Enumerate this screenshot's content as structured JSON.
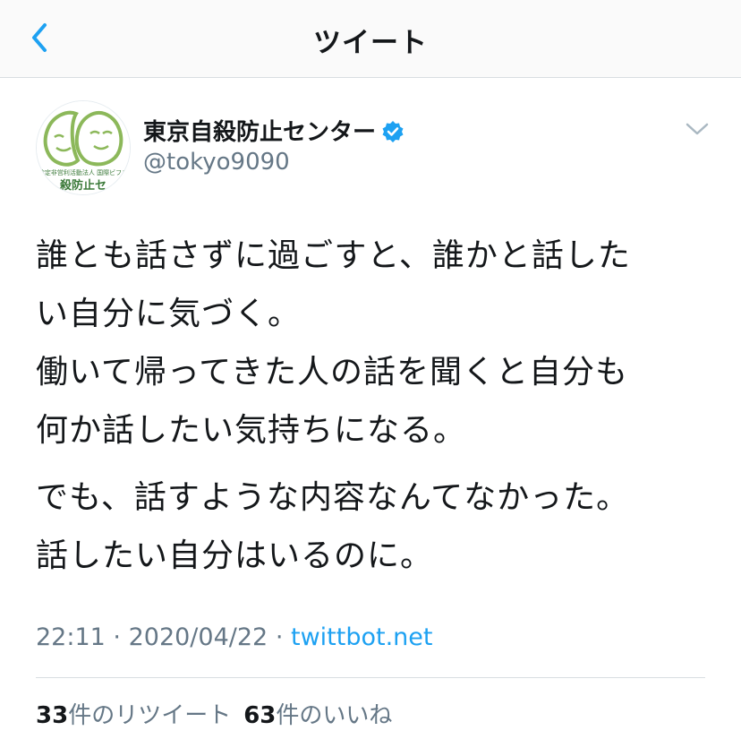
{
  "header": {
    "title": "ツイート",
    "back_icon": "chevron-left-icon"
  },
  "colors": {
    "accent": "#1da1f2",
    "secondary_text": "#657786",
    "primary_text": "#14171a",
    "avatar_green": "#8cb85a"
  },
  "author": {
    "name": "東京自殺防止センター",
    "handle": "@tokyo9090",
    "verified": true,
    "avatar_text_line1": "特定非営利活動法人 国際ビフレ",
    "avatar_text_line2": "殺防止セ"
  },
  "tweet": {
    "lines_para1": [
      "誰とも話さずに過ごすと、誰かと話した",
      "い自分に気づく。",
      "働いて帰ってきた人の話を聞くと自分も",
      "何か話したい気持ちになる。"
    ],
    "lines_para2": [
      "でも、話すような内容なんてなかった。",
      "話したい自分はいるのに。"
    ]
  },
  "meta": {
    "time": "22:11",
    "date": "2020/04/22",
    "separator": "·",
    "source": "twittbot.net"
  },
  "stats": {
    "retweets_count": "33",
    "retweets_label": "件のリツイート",
    "likes_count": "63",
    "likes_label": "件のいいね"
  }
}
